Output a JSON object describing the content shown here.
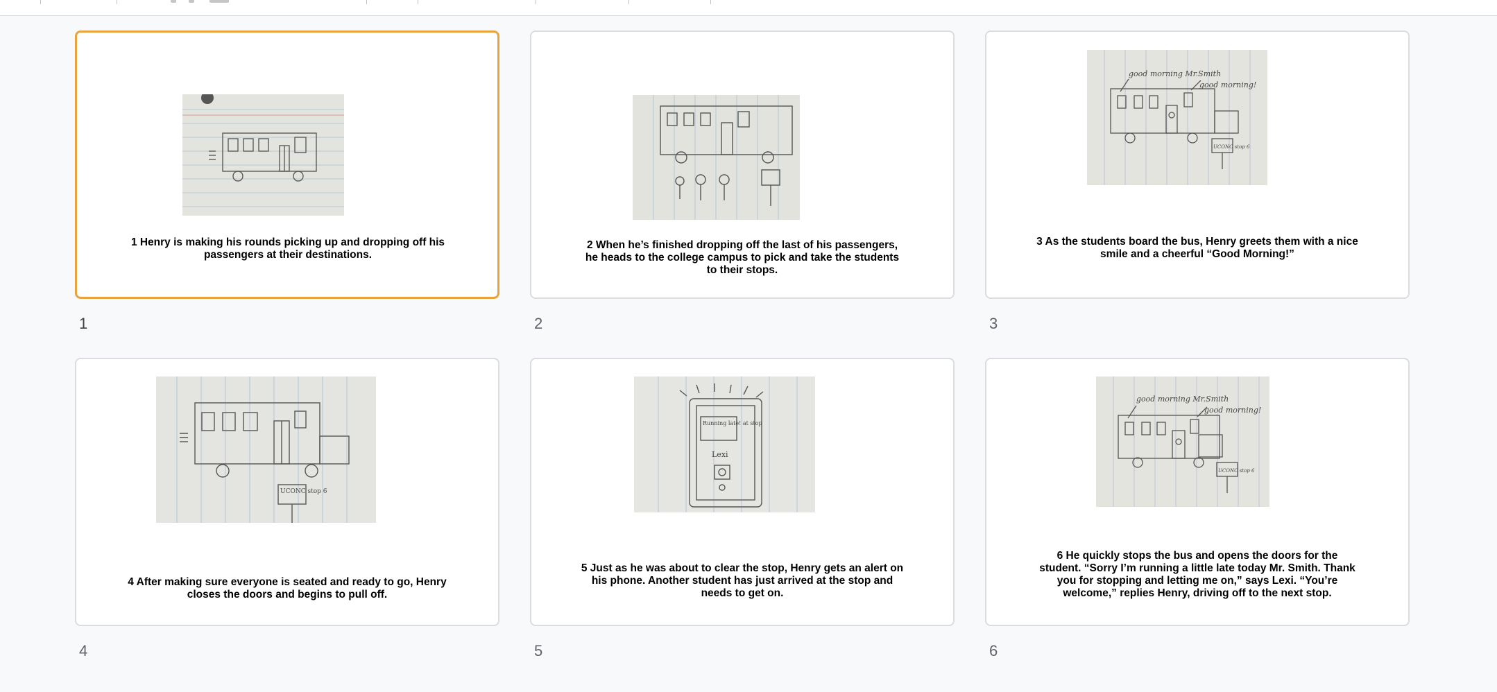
{
  "slides": [
    {
      "number": "1",
      "caption": "1 Henry is making his rounds picking up and dropping off his passengers at their destinations.",
      "image": "bus-with-passengers-drawing",
      "selected": true
    },
    {
      "number": "2",
      "caption": "2 When he’s finished dropping off the last of his passengers, he heads to the college campus to pick and take the students to their stops.",
      "image": "bus-and-students-at-stop-drawing",
      "selected": false
    },
    {
      "number": "3",
      "caption": "3 As the students board the bus, Henry greets them with a nice smile and a cheerful “Good Morning!”",
      "image": "students-boarding-bus-drawing",
      "selected": false,
      "sketch_text": {
        "left_bubble": "good morning Mr.Smith",
        "right_bubble": "good morning!",
        "sign": "UCONC stop 6"
      }
    },
    {
      "number": "4",
      "caption": "4 After making sure everyone is seated and ready to go, Henry closes the doors and begins to pull off.",
      "image": "bus-leaving-stop-drawing",
      "selected": false,
      "sketch_text": {
        "sign": "UCONC stop 6"
      }
    },
    {
      "number": "5",
      "caption": "5 Just as he was about to clear the stop, Henry gets an alert on his phone. Another student has just arrived at the stop and needs to get on.",
      "image": "phone-alert-drawing",
      "selected": false,
      "sketch_text": {
        "alert": "Running late! at stop",
        "name": "Lexi"
      }
    },
    {
      "number": "6",
      "caption": "6 He quickly stops the bus and opens the doors for the student. “Sorry I’m running a little late today Mr. Smith. Thank you for stopping and letting me on,” says Lexi. “You’re welcome,” replies Henry, driving off to the next stop.",
      "image": "bus-stops-for-student-drawing",
      "selected": false,
      "sketch_text": {
        "left_bubble": "good morning Mr.Smith",
        "right_bubble": "good morning!",
        "sign": "UCONC stop 6"
      }
    }
  ],
  "colors": {
    "selected_border": "#e8a33d",
    "card_border": "#dadce0",
    "background": "#f8f9fa"
  }
}
